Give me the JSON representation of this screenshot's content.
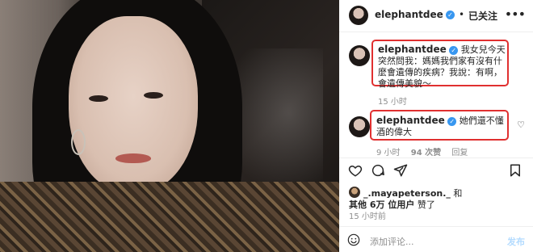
{
  "header": {
    "username": "elephantdee",
    "dot": "•",
    "follow_label": "已关注",
    "more_label": "•••"
  },
  "comments": [
    {
      "username": "elephantdee",
      "text": "我女兒今天突然問我：媽媽我們家有沒有什麼會遺傳的疾病？我說：有啊，會遺傳美貌～",
      "time": "15 小时"
    },
    {
      "username": "elephantdee",
      "text": "她們還不懂酒的偉大",
      "time": "9 小时",
      "likes": "94 次赞",
      "reply_label": "回复"
    }
  ],
  "likes": {
    "liker": "_.mayapeterson._",
    "and": "和",
    "others": "其他 6万 位用户",
    "liked": "赞了"
  },
  "post_time": "15 小时前",
  "add_comment": {
    "placeholder": "添加评论...",
    "post_label": "发布"
  },
  "colors": {
    "highlight_box": "#e03030",
    "verified": "#3897f0",
    "muted_text": "#8e8e8e",
    "post_disabled": "#b3dbff"
  },
  "icons": [
    "verified-badge-icon",
    "more-icon",
    "heart-icon",
    "comment-icon",
    "share-icon",
    "bookmark-icon",
    "emoji-icon"
  ]
}
